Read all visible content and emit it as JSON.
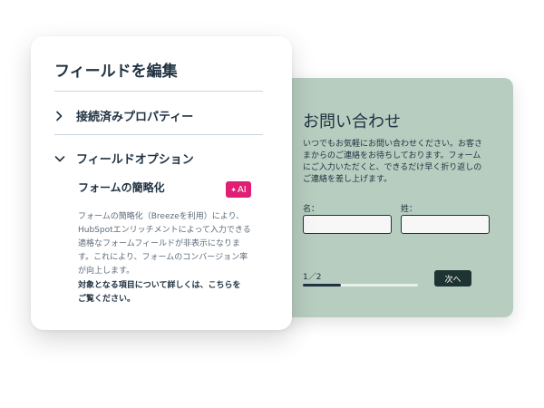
{
  "panel": {
    "title": "フィールドを編集",
    "sections": [
      {
        "label": "接続済みプロパティー",
        "expanded": false
      },
      {
        "label": "フィールドオプション",
        "expanded": true
      }
    ],
    "option_title": "フォームの簡略化",
    "ai_badge": "AI",
    "description_lines": [
      "フォームの簡略化（Breezeを利用）により、",
      "HubSpotエンリッチメントによって入力できる",
      "適格なフォームフィールドが非表示になりま",
      "す。これにより、フォームのコンバージョン率",
      "が向上します。"
    ],
    "description_bold_lines": [
      "対象となる項目について詳しくは、こちらを",
      "ご覧ください。"
    ]
  },
  "form": {
    "title": "お問い合わせ",
    "description_lines": [
      "いつでもお気軽にお問い合わせください。お客さ",
      "まからのご連絡をお待ちしております。フォーム",
      "にご入力いただくと、できるだけ早く折り返しの",
      "ご連絡を差し上げます。"
    ],
    "field_first_label": "名：",
    "field_last_label": "姓：",
    "pager": "1／2",
    "progress": 0.33,
    "next_label": "次へ"
  },
  "colors": {
    "form_bg": "#b7cdbf",
    "dark": "#213343",
    "button": "#1e3433",
    "ai_badge": "#e01e73"
  }
}
